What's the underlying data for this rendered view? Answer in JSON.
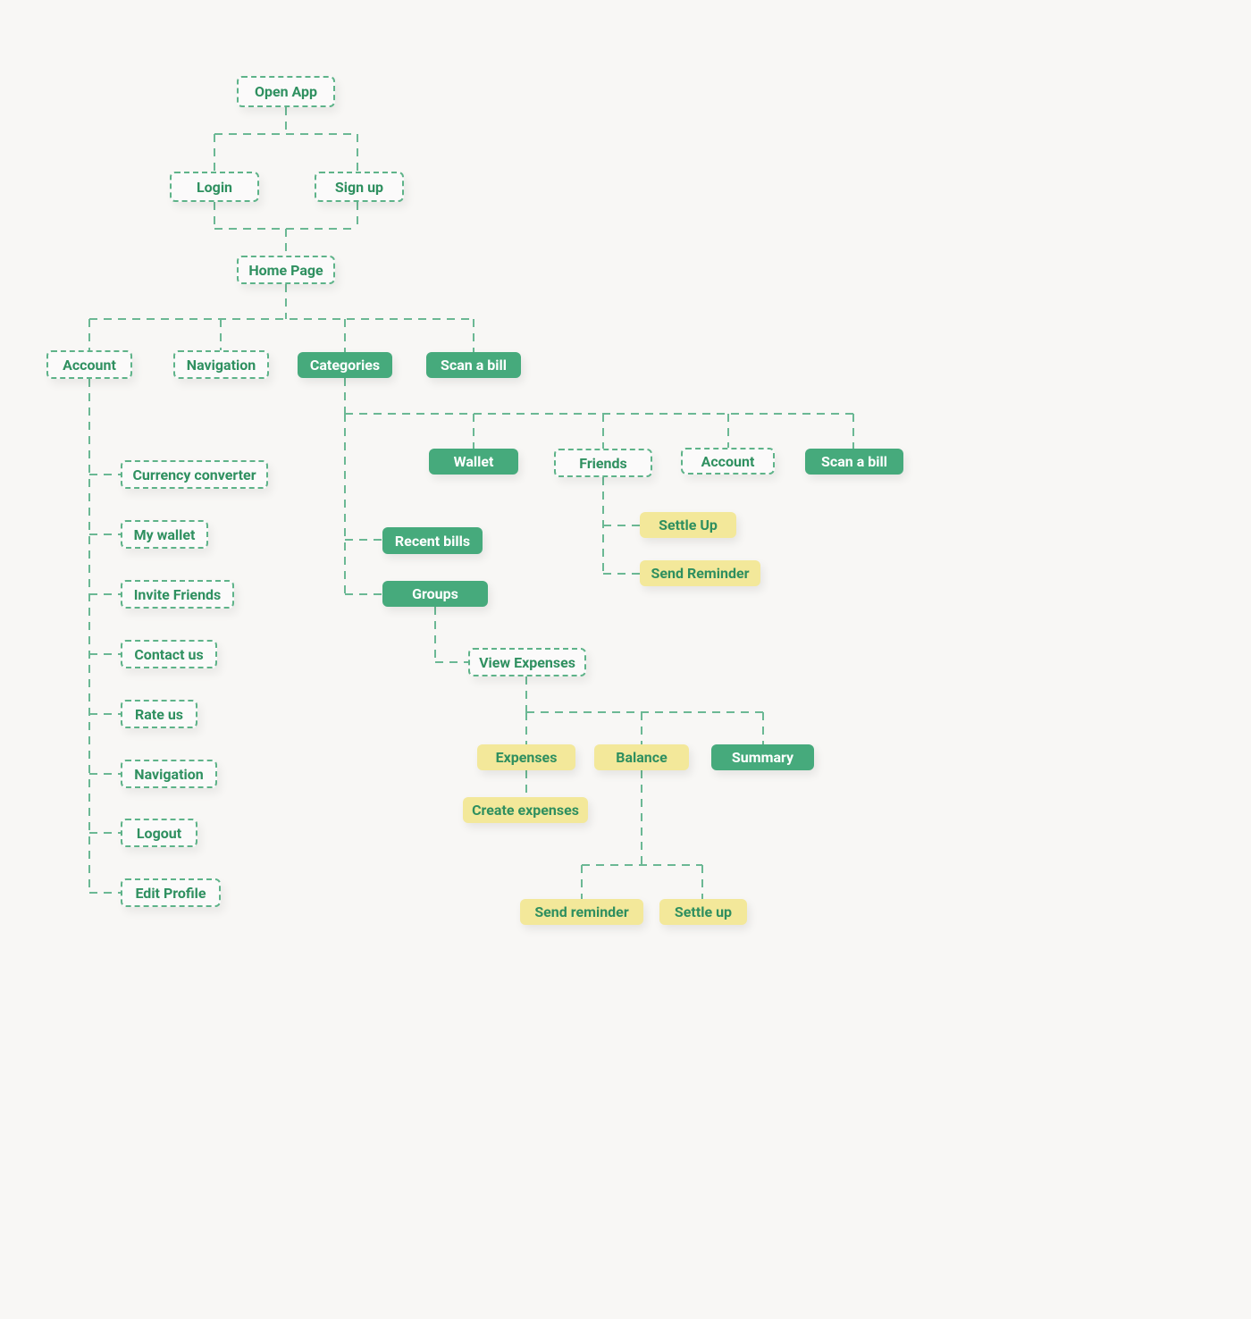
{
  "nodes": {
    "open_app": {
      "label": "Open App"
    },
    "login": {
      "label": "Login"
    },
    "sign_up": {
      "label": "Sign up"
    },
    "home_page": {
      "label": "Home Page"
    },
    "account": {
      "label": "Account"
    },
    "navigation": {
      "label": "Navigation"
    },
    "categories": {
      "label": "Categories"
    },
    "scan_a_bill": {
      "label": "Scan a bill"
    },
    "wallet": {
      "label": "Wallet"
    },
    "friends": {
      "label": "Friends"
    },
    "account2": {
      "label": "Account"
    },
    "scan_a_bill2": {
      "label": "Scan a bill"
    },
    "settle_up": {
      "label": "Settle Up"
    },
    "send_reminder": {
      "label": "Send Reminder"
    },
    "recent_bills": {
      "label": "Recent bills"
    },
    "groups": {
      "label": "Groups"
    },
    "view_expenses": {
      "label": "View Expenses"
    },
    "expenses": {
      "label": "Expenses"
    },
    "balance": {
      "label": "Balance"
    },
    "summary": {
      "label": "Summary"
    },
    "create_expenses": {
      "label": "Create expenses"
    },
    "send_reminder2": {
      "label": "Send reminder"
    },
    "settle_up2": {
      "label": "Settle up"
    },
    "currency_converter": {
      "label": "Currency converter"
    },
    "my_wallet": {
      "label": "My wallet"
    },
    "invite_friends": {
      "label": "Invite Friends"
    },
    "contact_us": {
      "label": "Contact us"
    },
    "rate_us": {
      "label": "Rate us"
    },
    "navigation2": {
      "label": "Navigation"
    },
    "logout": {
      "label": "Logout"
    },
    "edit_profile": {
      "label": "Edit Profile"
    }
  },
  "colors": {
    "green": "#46aa7c",
    "yellow": "#f3e89a",
    "text_green": "#2f9060",
    "bg": "#f8f7f5"
  },
  "diagram_type": "flowchart / sitemap"
}
